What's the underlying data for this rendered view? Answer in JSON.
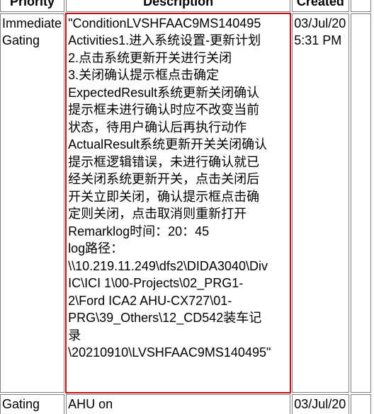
{
  "table": {
    "headers": {
      "priority": "Priority",
      "description": "Description",
      "created": "Created"
    },
    "rows": [
      {
        "priority": "Immediate Gating",
        "description_lines": [
          "\"ConditionLVSHFAAC9MS140495",
          "Activities1.进入系统设置-更新计划",
          "2.点击系统更新开关进行关闭",
          "3.关闭确认提示框点击确定",
          "ExpectedResult系统更新关闭确认",
          "提示框未进行确认时应不改变当前",
          "状态，待用户确认后再执行动作",
          "ActualResult系统更新开关关闭确认",
          "提示框逻辑错误，未进行确认就已",
          "经关闭系统更新开关，点击关闭后",
          "开关立即关闭，确认提示框点击确",
          "定则关闭，点击取消则重新打开",
          "Remarklog时间：20：45",
          "log路径：",
          "\\\\10.219.11.249\\dfs2\\DIDA3040\\Div",
          "IC\\ICI 1\\00-Projects\\02_PRG1-",
          "2\\Ford ICA2 AHU-CX727\\01-",
          "PRG\\39_Others\\12_CD542装车记",
          "录",
          "\\20210910\\LVSHFAAC9MS140495\""
        ],
        "created_lines": [
          "03/Jul/20",
          "5:31 PM"
        ],
        "selected": true
      },
      {
        "priority": "Gating",
        "description_lines": [
          "AHU on"
        ],
        "created_lines": [
          "03/Jul/20"
        ],
        "selected": false
      }
    ]
  },
  "colors": {
    "selection_border": "#c0141b",
    "cell_border": "#808080",
    "background": "#ffffff"
  }
}
